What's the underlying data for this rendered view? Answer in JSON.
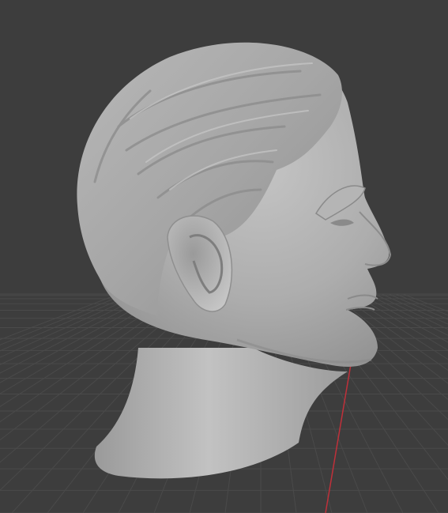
{
  "viewport": {
    "background_color": "#3d3d3d",
    "grid_color": "#4a4a4a",
    "x_axis_color": "#c0303a",
    "mesh_color": "#a9a9a9",
    "mesh_highlight_color": "#c9c9c9",
    "mesh_shadow_color": "#7a7a7a"
  },
  "object": {
    "icon": "sculpted-head-mesh"
  }
}
